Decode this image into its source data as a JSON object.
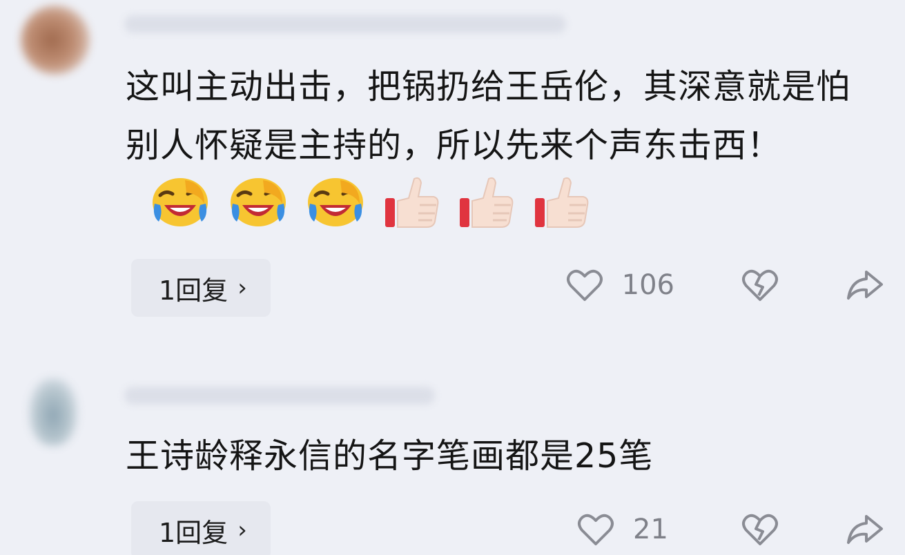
{
  "comments": [
    {
      "text": "这叫主动出击，把锅扔给王岳伦，其深意就是怕别人怀疑是主持的，所以先来个声东击西！",
      "emojis": [
        "face-with-tears-of-joy-icon",
        "face-with-tears-of-joy-icon",
        "face-with-tears-of-joy-icon",
        "thumbs-up-icon",
        "thumbs-up-icon",
        "thumbs-up-icon"
      ],
      "reply_label": "1回复",
      "likes": "106"
    },
    {
      "text": "王诗龄释永信的名字笔画都是25笔",
      "reply_label": "1回复",
      "likes": "21"
    }
  ],
  "icons": {
    "like": "heart-outline-icon",
    "dislike": "broken-heart-icon",
    "share": "share-arrow-icon",
    "reply_chevron": "chevron-right-icon"
  },
  "colors": {
    "background": "#eef0f6",
    "text": "#151515",
    "muted": "#888a92",
    "pill": "#e6e8ef"
  },
  "reply_chevron_glyph": "›"
}
